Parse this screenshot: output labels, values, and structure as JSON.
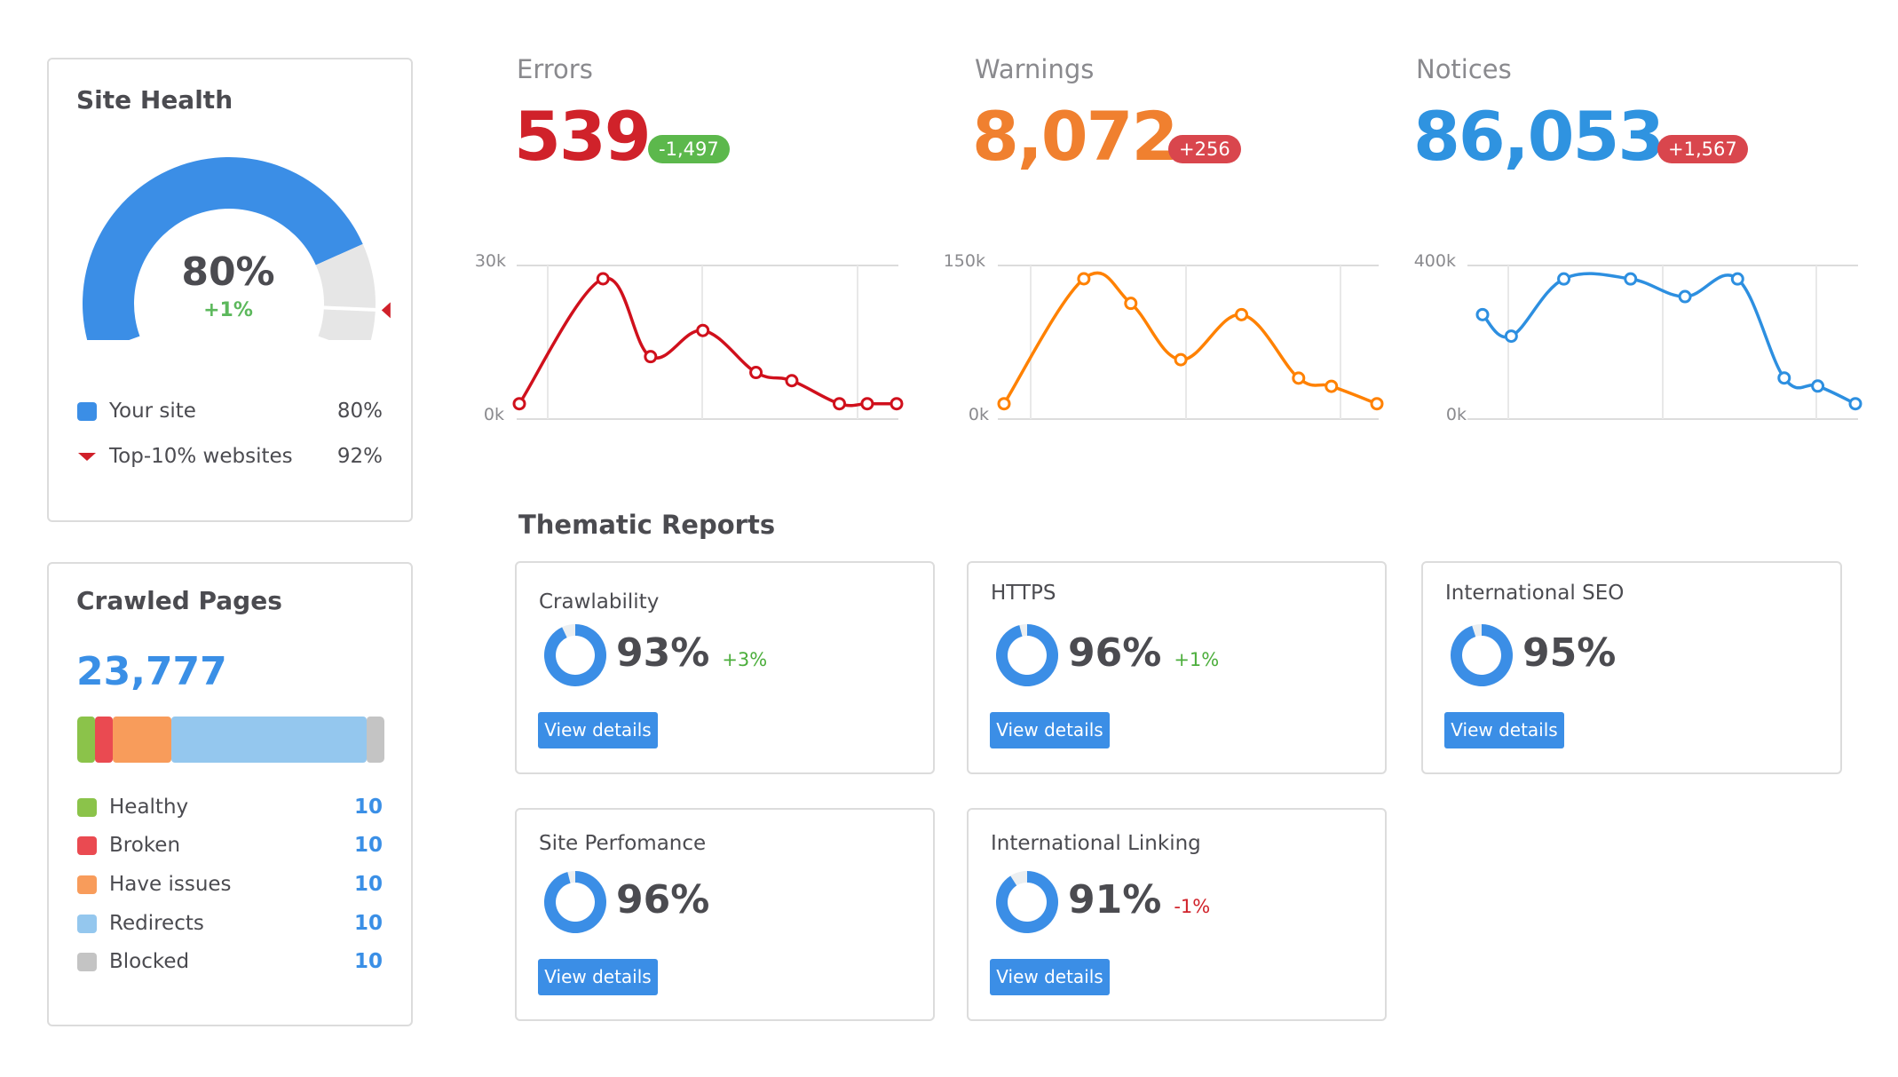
{
  "site_health": {
    "title": "Site Health",
    "score": "80%",
    "score_value": 80,
    "delta": "+1%",
    "top10_value": 92,
    "legend": [
      {
        "label": "Your site",
        "value": "80%",
        "marker": "square",
        "color": "#3b8ee6"
      },
      {
        "label": "Top-10% websites",
        "value": "92%",
        "marker": "triangle-down",
        "color": "#d0202a"
      }
    ],
    "colors": {
      "filled": "#3b8ee6",
      "empty": "#e6e6e6",
      "delta": "#5cb85c"
    }
  },
  "crawled_pages": {
    "title": "Crawled Pages",
    "total": "23,777",
    "bar_fractions": [
      0.058,
      0.058,
      0.19,
      0.636,
      0.058
    ],
    "legend": [
      {
        "label": "Healthy",
        "value": "10",
        "color": "#8bc34a"
      },
      {
        "label": "Broken",
        "value": "10",
        "color": "#ea4a51"
      },
      {
        "label": "Have issues",
        "value": "10",
        "color": "#f89c5b"
      },
      {
        "label": "Redirects",
        "value": "10",
        "color": "#94c7ee"
      },
      {
        "label": "Blocked",
        "value": "10",
        "color": "#c4c4c4"
      }
    ]
  },
  "metrics": [
    {
      "label": "Errors",
      "value": "539",
      "value_color": "#d0222a",
      "badge": "-1,497",
      "badge_color": "#5cb84c"
    },
    {
      "label": "Warnings",
      "value": "8,072",
      "value_color": "#f0802f",
      "badge": "+256",
      "badge_color": "#d9464d"
    },
    {
      "label": "Notices",
      "value": "86,053",
      "value_color": "#2f93e0",
      "badge": "+1,567",
      "badge_color": "#d9464d"
    }
  ],
  "chart_data": [
    {
      "type": "line",
      "title": "Errors",
      "color": "#d0101c",
      "ylim": [
        0,
        30
      ],
      "ytick_labels": [
        "0k",
        "30k"
      ],
      "grid": true,
      "x": [
        1,
        2,
        3,
        4,
        5,
        6,
        7,
        8,
        9
      ],
      "values": [
        3.0,
        27.4,
        12.2,
        17.3,
        9.1,
        7.5,
        3.0,
        3.0,
        3.0
      ],
      "units": "thousands"
    },
    {
      "type": "line",
      "title": "Warnings",
      "color": "#ff8100",
      "ylim": [
        0,
        150
      ],
      "ytick_labels": [
        "0k",
        "150k"
      ],
      "grid": true,
      "x": [
        1,
        2,
        3,
        4,
        5,
        6,
        7,
        8
      ],
      "values": [
        15,
        137,
        113,
        58,
        102,
        40,
        32,
        15
      ],
      "units": "thousands"
    },
    {
      "type": "line",
      "title": "Notices",
      "color": "#2d8fe0",
      "ylim": [
        0,
        400
      ],
      "ytick_labels": [
        "0k",
        "400k"
      ],
      "grid": true,
      "x": [
        1,
        2,
        3,
        4,
        5,
        6,
        7,
        8,
        9
      ],
      "values": [
        272,
        216,
        365,
        365,
        319,
        365,
        107,
        86,
        40
      ],
      "units": "thousands"
    }
  ],
  "thematic": {
    "title": "Thematic Reports",
    "button_label": "View details",
    "reports": [
      {
        "title": "Crawlability",
        "pct": "93%",
        "value": 93,
        "delta": "+3%",
        "delta_type": "up"
      },
      {
        "title": "HTTPS",
        "pct": "96%",
        "value": 96,
        "delta": "+1%",
        "delta_type": "up"
      },
      {
        "title": "International SEO",
        "pct": "95%",
        "value": 95,
        "delta": "",
        "delta_type": "none"
      },
      {
        "title": "Site Perfomance",
        "pct": "96%",
        "value": 96,
        "delta": "",
        "delta_type": "none"
      },
      {
        "title": "International Linking",
        "pct": "91%",
        "value": 91,
        "delta": "-1%",
        "delta_type": "down"
      }
    ]
  }
}
